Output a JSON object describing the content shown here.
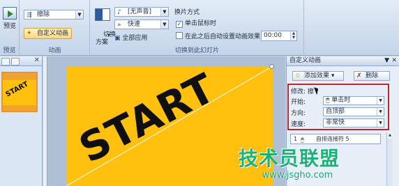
{
  "ribbon": {
    "preview": {
      "label": "预览",
      "group_label": "预览"
    },
    "animations": {
      "effect_select": "擦除",
      "custom_animation_button": "自定义动画",
      "group_label": "动画"
    },
    "transition": {
      "scheme_label": "切换\n方案",
      "scheme_dropdown": "▾",
      "sound_select": "[无声音]",
      "speed_select": "快速",
      "apply_all": "全部应用",
      "advance_title": "换片方式",
      "on_click": "单击鼠标时",
      "on_click_checked": "✓",
      "after_time": "在此之后自动设置动画效果:",
      "time_value": "00:00",
      "group_label": "切换到此幻灯片"
    }
  },
  "thumbnail": {
    "text": "START",
    "close": "✕"
  },
  "slide": {
    "text": "START"
  },
  "pane": {
    "title": "自定义动画",
    "title_ctrl_dropdown": "▼",
    "title_ctrl_close": "✕",
    "add_effect": "添加效果 ▾",
    "remove": "删除",
    "modify_label": "修改: 擦",
    "start_label": "开始:",
    "start_value": "单击时",
    "direction_label": "方向:",
    "direction_value": "自顶部",
    "speed_label": "速度:",
    "speed_value": "非常快",
    "list_number": "1",
    "list_text": "自排连接符 5"
  },
  "watermark": {
    "main": "技术员联盟",
    "sub": "www.jsgho.com"
  }
}
